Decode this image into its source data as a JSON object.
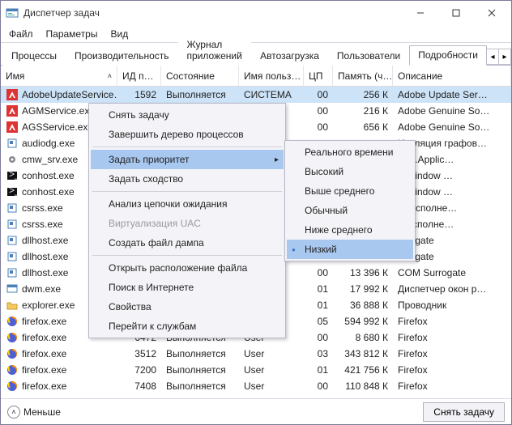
{
  "window": {
    "title": "Диспетчер задач"
  },
  "menu": {
    "file": "Файл",
    "options": "Параметры",
    "view": "Вид"
  },
  "tabs": {
    "t0": "Процессы",
    "t1": "Производительность",
    "t2": "Журнал приложений",
    "t3": "Автозагрузка",
    "t4": "Пользователи",
    "t5": "Подробности"
  },
  "cols": {
    "name": "Имя",
    "pid": "ИД п…",
    "state": "Состояние",
    "user": "Имя польз…",
    "cpu": "ЦП",
    "mem": "Память (ч…",
    "desc": "Описание"
  },
  "rows": [
    {
      "name": "AdobeUpdateService…",
      "pid": "1592",
      "state": "Выполняется",
      "user": "СИСТЕМА",
      "cpu": "00",
      "mem": "256 К",
      "desc": "Adobe Update Ser…",
      "ic": "adobe",
      "sel": true
    },
    {
      "name": "AGMService.exe",
      "pid": "",
      "state": "",
      "user": "ЛА",
      "cpu": "00",
      "mem": "216 К",
      "desc": "Adobe Genuine So…",
      "ic": "adobe"
    },
    {
      "name": "AGSService.exe",
      "pid": "",
      "state": "",
      "user": "ЛА",
      "cpu": "00",
      "mem": "656 К",
      "desc": "Adobe Genuine So…",
      "ic": "adobe"
    },
    {
      "name": "audiodg.exe",
      "pid": "",
      "state": "",
      "user": "",
      "cpu": "",
      "mem": "",
      "desc": "Изоляция графов…",
      "ic": "exe"
    },
    {
      "name": "cmw_srv.exe",
      "pid": "",
      "state": "",
      "user": "",
      "cpu": "",
      "mem": "",
      "desc": "vice.Applic…",
      "ic": "cog"
    },
    {
      "name": "conhost.exe",
      "pid": "",
      "state": "",
      "user": "",
      "cpu": "",
      "mem": "",
      "desc": "e Window …",
      "ic": "con"
    },
    {
      "name": "conhost.exe",
      "pid": "",
      "state": "",
      "user": "",
      "cpu": "",
      "mem": "",
      "desc": "e Window …",
      "ic": "con"
    },
    {
      "name": "csrss.exe",
      "pid": "",
      "state": "",
      "user": "",
      "cpu": "",
      "mem": "",
      "desc": "сс исполне…",
      "ic": "exe"
    },
    {
      "name": "csrss.exe",
      "pid": "",
      "state": "",
      "user": "",
      "cpu": "",
      "mem": "",
      "desc": "S исполне…",
      "ic": "exe"
    },
    {
      "name": "dllhost.exe",
      "pid": "",
      "state": "",
      "user": "",
      "cpu": "",
      "mem": "",
      "desc": "urrogate",
      "ic": "exe"
    },
    {
      "name": "dllhost.exe",
      "pid": "",
      "state": "",
      "user": "",
      "cpu": "",
      "mem": "",
      "desc": "urrogate",
      "ic": "exe"
    },
    {
      "name": "dllhost.exe",
      "pid": "",
      "state": "",
      "user": "",
      "cpu": "00",
      "mem": "13 396 К",
      "desc": "COM Surrogate",
      "ic": "exe"
    },
    {
      "name": "dwm.exe",
      "pid": "",
      "state": "",
      "user": "",
      "cpu": "01",
      "mem": "17 992 К",
      "desc": "Диспетчер окон р…",
      "ic": "dwm"
    },
    {
      "name": "explorer.exe",
      "pid": "",
      "state": "",
      "user": "",
      "cpu": "01",
      "mem": "36 888 К",
      "desc": "Проводник",
      "ic": "folder"
    },
    {
      "name": "firefox.exe",
      "pid": "",
      "state": "",
      "user": "",
      "cpu": "05",
      "mem": "594 992 К",
      "desc": "Firefox",
      "ic": "ff"
    },
    {
      "name": "firefox.exe",
      "pid": "6472",
      "state": "Выполняется",
      "user": "User",
      "cpu": "00",
      "mem": "8 680 К",
      "desc": "Firefox",
      "ic": "ff"
    },
    {
      "name": "firefox.exe",
      "pid": "3512",
      "state": "Выполняется",
      "user": "User",
      "cpu": "03",
      "mem": "343 812 К",
      "desc": "Firefox",
      "ic": "ff"
    },
    {
      "name": "firefox.exe",
      "pid": "7200",
      "state": "Выполняется",
      "user": "User",
      "cpu": "01",
      "mem": "421 756 К",
      "desc": "Firefox",
      "ic": "ff"
    },
    {
      "name": "firefox.exe",
      "pid": "7408",
      "state": "Выполняется",
      "user": "User",
      "cpu": "00",
      "mem": "110 848 К",
      "desc": "Firefox",
      "ic": "ff"
    }
  ],
  "ctx": {
    "endtask": "Снять задачу",
    "endtree": "Завершить дерево процессов",
    "setprio": "Задать приоритет",
    "affinity": "Задать сходство",
    "waitchain": "Анализ цепочки ожидания",
    "uacvirt": "Виртуализация UAC",
    "dump": "Создать файл дампа",
    "openloc": "Открыть расположение файла",
    "search": "Поиск в Интернете",
    "props": "Свойства",
    "gotosvc": "Перейти к службам"
  },
  "prio": {
    "realtime": "Реального времени",
    "high": "Высокий",
    "above": "Выше среднего",
    "normal": "Обычный",
    "below": "Ниже среднего",
    "low": "Низкий"
  },
  "footer": {
    "less": "Меньше",
    "endtask": "Снять задачу"
  }
}
